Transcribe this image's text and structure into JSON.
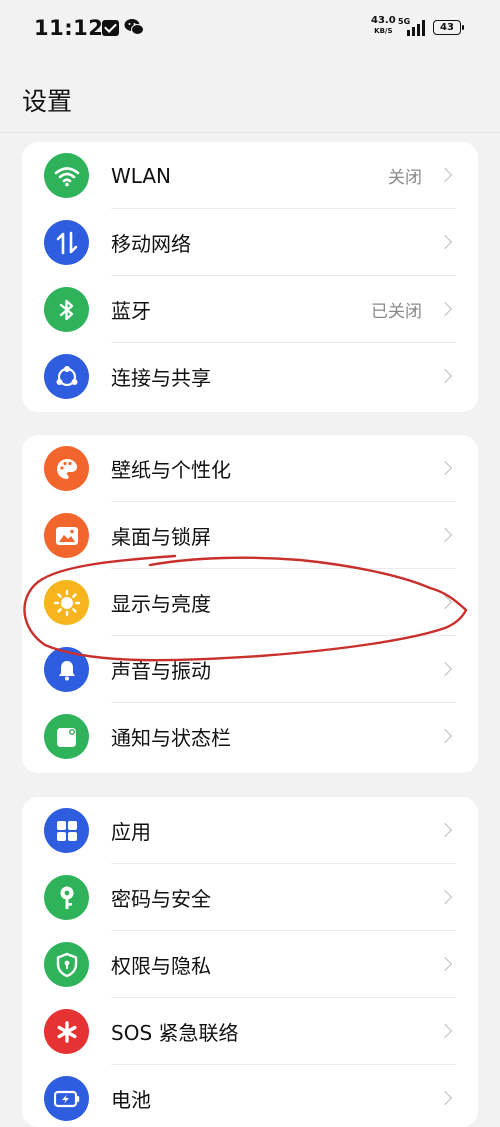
{
  "status_bar": {
    "time": "11:12",
    "net_speed": "43.0",
    "net_unit": "KB/S",
    "network_type": "5G",
    "battery": "43"
  },
  "page": {
    "title": "设置"
  },
  "sections": [
    {
      "items": [
        {
          "label": "WLAN",
          "value": "关闭",
          "icon": "wifi-icon",
          "color": "#2fb35a"
        },
        {
          "label": "移动网络",
          "value": "",
          "icon": "mobile-data-icon",
          "color": "#2f5de0"
        },
        {
          "label": "蓝牙",
          "value": "已关闭",
          "icon": "bluetooth-icon",
          "color": "#2fb35a"
        },
        {
          "label": "连接与共享",
          "value": "",
          "icon": "share-icon",
          "color": "#2f5de0"
        }
      ]
    },
    {
      "items": [
        {
          "label": "壁纸与个性化",
          "value": "",
          "icon": "palette-icon",
          "color": "#f2662d"
        },
        {
          "label": "桌面与锁屏",
          "value": "",
          "icon": "image-icon",
          "color": "#f2662d"
        },
        {
          "label": "显示与亮度",
          "value": "",
          "icon": "sun-icon",
          "color": "#f6b51d"
        },
        {
          "label": "声音与振动",
          "value": "",
          "icon": "bell-icon",
          "color": "#2f5de0"
        },
        {
          "label": "通知与状态栏",
          "value": "",
          "icon": "notification-icon",
          "color": "#2fb35a"
        }
      ]
    },
    {
      "items": [
        {
          "label": "应用",
          "value": "",
          "icon": "apps-icon",
          "color": "#2f5de0"
        },
        {
          "label": "密码与安全",
          "value": "",
          "icon": "key-icon",
          "color": "#2fb35a"
        },
        {
          "label": "权限与隐私",
          "value": "",
          "icon": "shield-icon",
          "color": "#2fb35a"
        },
        {
          "label": "SOS 紧急联络",
          "value": "",
          "icon": "sos-icon",
          "color": "#e63232"
        },
        {
          "label": "电池",
          "value": "",
          "icon": "battery-icon",
          "color": "#2f5de0"
        }
      ]
    }
  ],
  "annotation_color": "#c9302c"
}
